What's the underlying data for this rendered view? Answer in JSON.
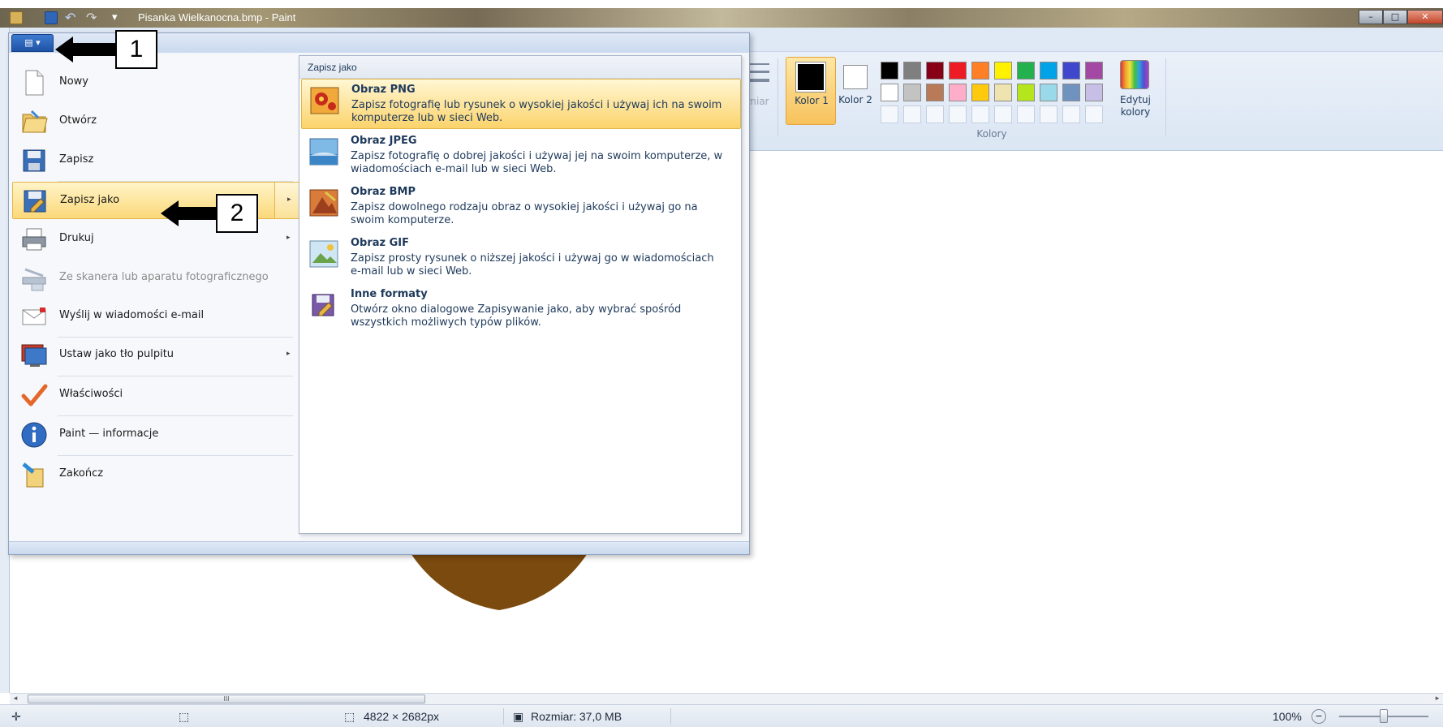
{
  "window": {
    "title": "Pisanka Wielkanocna.bmp - Paint",
    "controls": {
      "minimize": "–",
      "maximize": "□",
      "close": "✕"
    }
  },
  "quick_access": {
    "undo": "↶",
    "redo": "↷",
    "customize": "▾"
  },
  "file_button": {
    "label": "▤ ▾"
  },
  "ribbon": {
    "size_label": "zmiar",
    "color1_label": "Kolor 1",
    "color2_label": "Kolor 2",
    "colors_group_label": "Kolory",
    "edit_colors_label": "Edytuj kolory",
    "palette_row1": [
      "#000000",
      "#7f7f7f",
      "#880015",
      "#ed1c24",
      "#ff7f27",
      "#fff200",
      "#22b14c",
      "#00a2e8",
      "#3f48cc",
      "#a349a4"
    ],
    "palette_row2": [
      "#ffffff",
      "#c3c3c3",
      "#b97a57",
      "#ffaec9",
      "#ffc90e",
      "#efe4b0",
      "#b5e61d",
      "#99d9ea",
      "#7092be",
      "#c8bfe7"
    ]
  },
  "file_menu": {
    "items": [
      {
        "label": "Nowy",
        "icon": "new-document-icon",
        "disabled": false,
        "arrow": false
      },
      {
        "label": "Otwórz",
        "icon": "open-folder-icon",
        "disabled": false,
        "arrow": false
      },
      {
        "label": "Zapisz",
        "icon": "save-disk-icon",
        "disabled": false,
        "arrow": false
      },
      {
        "label": "Zapisz jako",
        "icon": "save-as-icon",
        "disabled": false,
        "arrow": true,
        "highlighted": true
      },
      {
        "label": "Drukuj",
        "icon": "printer-icon",
        "disabled": false,
        "arrow": true
      },
      {
        "label": "Ze skanera lub aparatu fotograficznego",
        "icon": "scanner-icon",
        "disabled": true,
        "arrow": false
      },
      {
        "label": "Wyślij w wiadomości e-mail",
        "icon": "email-icon",
        "disabled": false,
        "arrow": false
      },
      {
        "label": "Ustaw jako tło pulpitu",
        "icon": "desktop-background-icon",
        "disabled": false,
        "arrow": true
      },
      {
        "label": "Właściwości",
        "icon": "checkmark-icon",
        "disabled": false,
        "arrow": false
      },
      {
        "label": "Paint — informacje",
        "icon": "info-icon",
        "disabled": false,
        "arrow": false
      },
      {
        "label": "Zakończ",
        "icon": "exit-icon",
        "disabled": false,
        "arrow": false
      }
    ]
  },
  "submenu": {
    "header": "Zapisz jako",
    "items": [
      {
        "title": "Obraz PNG",
        "description": "Zapisz fotografię lub rysunek o wysokiej jakości i używaj ich na swoim komputerze lub w sieci Web.",
        "icon": "png-image-icon",
        "highlighted": true
      },
      {
        "title": "Obraz JPEG",
        "description": "Zapisz fotografię o dobrej jakości i używaj jej na swoim komputerze, w wiadomościach e-mail lub w sieci Web.",
        "icon": "jpeg-image-icon"
      },
      {
        "title": "Obraz BMP",
        "description": "Zapisz dowolnego rodzaju obraz o wysokiej jakości i używaj go na swoim komputerze.",
        "icon": "bmp-image-icon"
      },
      {
        "title": "Obraz GIF",
        "description": "Zapisz prosty rysunek o niższej jakości i używaj go w wiadomościach e-mail lub w sieci Web.",
        "icon": "gif-image-icon"
      },
      {
        "title": "Inne formaty",
        "description": "Otwórz okno dialogowe Zapisywanie jako, aby wybrać spośród wszystkich możliwych typów plików.",
        "icon": "other-formats-icon"
      }
    ]
  },
  "callouts": {
    "one": "1",
    "two": "2"
  },
  "scrollbar": {
    "left": "◂",
    "thumb": "III",
    "right": "▸"
  },
  "status": {
    "move_icon": "✛",
    "selection_icon": "⬚",
    "dimensions": "4822 × 2682px",
    "size": "Rozmiar: 37,0 MB",
    "zoom": "100%",
    "zoom_minus": "−"
  },
  "colors": {
    "highlight": "#fbd879",
    "egg_yellow": "#f5e10a",
    "egg_brown": "#7b4a0e"
  }
}
